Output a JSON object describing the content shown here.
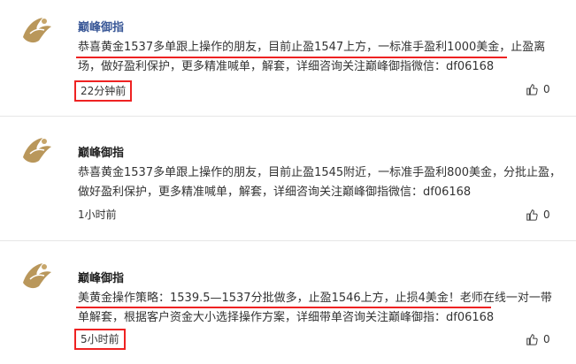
{
  "comments": [
    {
      "author": "巅峰御指",
      "author_color": "#3b5998",
      "text": "恭喜黄金1537多单跟上操作的朋友，目前止盈1547上方，一标准手盈利1000美金，止盈离场，做好盈利保护，更多精准喊单，解套，详细咨询关注巅峰御指微信：df06168",
      "time": "22分钟前",
      "likes": "0",
      "icon": "thumbs-up-icon"
    },
    {
      "author": "巅峰御指",
      "author_color": "#222222",
      "text": "恭喜黄金1537多单跟上操作的朋友，目前止盈1545附近，一标准手盈利800美金，分批止盈，做好盈利保护，更多精准喊单，解套，详细咨询关注巅峰御指微信：df06168",
      "time": "1小时前",
      "likes": "0",
      "icon": "thumbs-up-icon"
    },
    {
      "author": "巅峰御指",
      "author_color": "#222222",
      "text": "美黄金操作策略：1539.5—1537分批做多，止盈1546上方，止损4美金！老师在线一对一带单解套，根据客户资金大小选择操作方案，详细带单咨询关注巅峰御指：df06168",
      "time": "5小时前",
      "likes": "0",
      "icon": "thumbs-up-icon"
    }
  ],
  "highlight_color": "#e22222"
}
